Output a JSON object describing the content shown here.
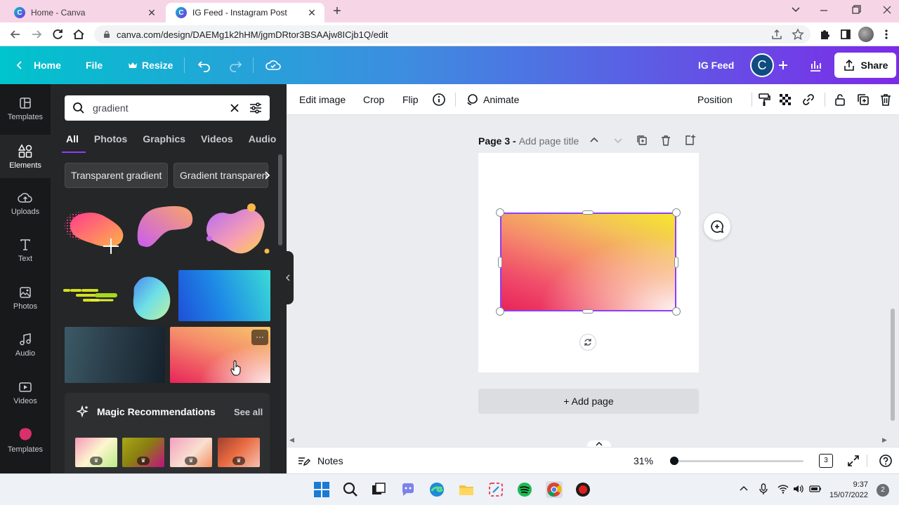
{
  "browser": {
    "tabs": [
      {
        "title": "Home - Canva",
        "favicon": "C",
        "active": false
      },
      {
        "title": "IG Feed - Instagram Post",
        "favicon": "C",
        "active": true
      }
    ],
    "close_glyph": "✕",
    "new_tab_glyph": "+",
    "url": "canva.com/design/DAEMg1k2hHM/jgmDRtor3BSAAjw8ICjb1Q/edit"
  },
  "header": {
    "home_label": "Home",
    "file_label": "File",
    "resize_label": "Resize",
    "design_title": "IG Feed",
    "avatar_initial": "C",
    "share_label": "Share",
    "gradient_colors": [
      "#00c4cc",
      "#3d8de0",
      "#7d2ae8"
    ]
  },
  "rail": {
    "items": [
      {
        "label": "Templates",
        "icon": "templates-icon"
      },
      {
        "label": "Elements",
        "icon": "elements-icon",
        "active": true
      },
      {
        "label": "Uploads",
        "icon": "uploads-icon"
      },
      {
        "label": "Text",
        "icon": "text-icon"
      },
      {
        "label": "Photos",
        "icon": "photos-icon"
      },
      {
        "label": "Audio",
        "icon": "audio-icon"
      },
      {
        "label": "Videos",
        "icon": "videos-icon"
      },
      {
        "label": "Templates",
        "icon": "templates-blob-icon"
      }
    ]
  },
  "panel": {
    "search_value": "gradient",
    "tabs": [
      "All",
      "Photos",
      "Graphics",
      "Videos",
      "Audio"
    ],
    "active_tab": "All",
    "chips": [
      "Transparent gradient",
      "Gradient transparent"
    ],
    "more_glyph": "···",
    "magic_title": "Magic Recommendations",
    "magic_see_all": "See all",
    "crown_glyph": "♛"
  },
  "toolbar": {
    "edit_image": "Edit image",
    "crop": "Crop",
    "flip": "Flip",
    "animate": "Animate",
    "position": "Position"
  },
  "canvas": {
    "page_label": "Page 3 -",
    "page_title_placeholder": "Add page title",
    "add_page": "+ Add page",
    "selection_color": "#8b3dff"
  },
  "bottom": {
    "notes_label": "Notes",
    "zoom_label": "31%",
    "zoom_fraction": 0.0,
    "page_count": "3"
  },
  "taskbar": {
    "time": "9:37",
    "date": "15/07/2022",
    "notifications": "2"
  }
}
